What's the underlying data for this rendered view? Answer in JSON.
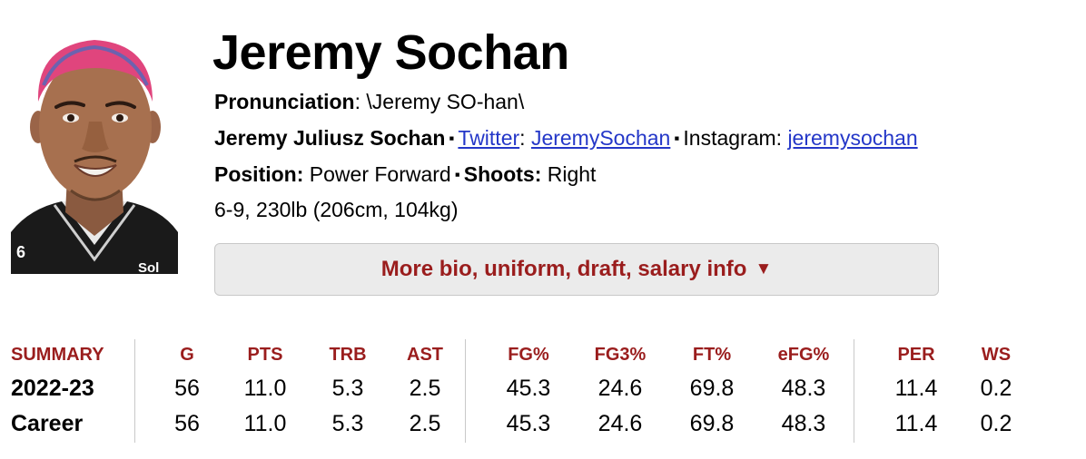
{
  "player": {
    "name": "Jeremy Sochan",
    "pronunciation_label": "Pronunciation",
    "pronunciation": ": \\Jeremy SO-han\\",
    "full_name": "Jeremy Juliusz Sochan",
    "twitter_label": "Twitter",
    "twitter_handle": "JeremySochan",
    "instagram_label": "Instagram: ",
    "instagram_handle": "jeremysochan",
    "position_label": "Position:",
    "position": "Power Forward",
    "shoots_label": "Shoots:",
    "shoots": "Right",
    "measurements": "6-9, 230lb (206cm, 104kg)",
    "separator": "▪"
  },
  "more_info_button": {
    "label": "More bio, uniform, draft, salary info",
    "arrow": "▼"
  },
  "summary": {
    "title": "SUMMARY",
    "columns": [
      "G",
      "PTS",
      "TRB",
      "AST",
      "FG%",
      "FG3%",
      "FT%",
      "eFG%",
      "PER",
      "WS"
    ],
    "rows": [
      {
        "label": "2022-23",
        "values": [
          "56",
          "11.0",
          "5.3",
          "2.5",
          "45.3",
          "24.6",
          "69.8",
          "48.3",
          "11.4",
          "0.2"
        ]
      },
      {
        "label": "Career",
        "values": [
          "56",
          "11.0",
          "5.3",
          "2.5",
          "45.3",
          "24.6",
          "69.8",
          "48.3",
          "11.4",
          "0.2"
        ]
      }
    ]
  },
  "photo": {
    "jersey_number": "6",
    "jersey_text": "Sol"
  },
  "colors": {
    "accent_red": "#9a1d1d",
    "link_blue": "#2437c8",
    "button_bg": "#ebebeb",
    "hair_pink": "#e0457d"
  }
}
